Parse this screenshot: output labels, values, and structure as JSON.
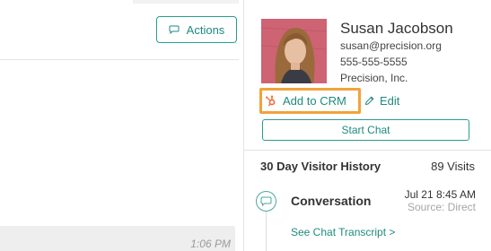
{
  "conversation_pane": {
    "actions_label": "Actions",
    "last_message_time": "1:06 PM"
  },
  "contact": {
    "name": "Susan Jacobson",
    "email": "susan@precision.org",
    "phone": "555-555-5555",
    "company": "Precision, Inc.",
    "add_crm_label": "Add to CRM",
    "edit_label": "Edit",
    "start_chat_label": "Start Chat"
  },
  "visitor_history": {
    "title": "30 Day Visitor History",
    "visits": "89 Visits",
    "entries": [
      {
        "type": "Conversation",
        "date": "Jul 21 8:45 AM",
        "source": "Source: Direct",
        "link_label": "See Chat Transcript >"
      }
    ]
  },
  "colors": {
    "accent": "#1f8a7e",
    "highlight": "#f0a33a",
    "hubspot": "#f26b3a"
  },
  "icons": {
    "actions": "chat-bubble-icon",
    "add_crm": "hubspot-sprocket-icon",
    "edit": "pencil-icon",
    "conversation": "chat-bubble-icon"
  }
}
